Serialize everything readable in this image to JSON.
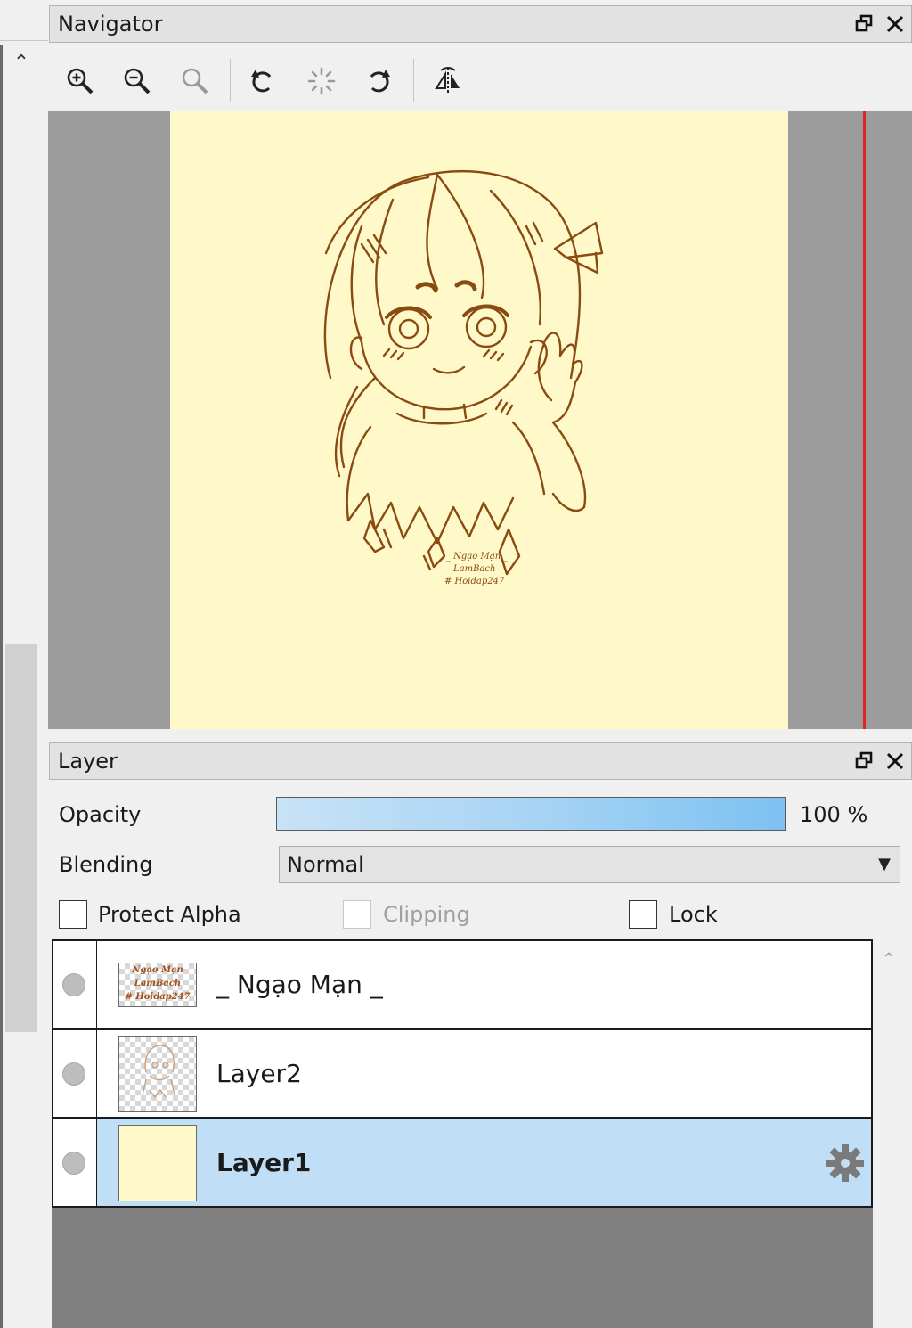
{
  "colors": {
    "panel_bg": "#f0f0f0",
    "titlebar_bg": "#e2e2e2",
    "canvas_bg": "#fff8c8",
    "view_bg": "#9c9c9c",
    "accent_red": "#e0231c",
    "selected_row": "#c0dff7",
    "sketch_line": "#8a4b12"
  },
  "left_strip": {
    "scroll_up_glyph": "⌃"
  },
  "navigator": {
    "title": "Navigator",
    "window_buttons": [
      "restore-icon",
      "close-icon"
    ],
    "toolbar": [
      "zoom-in-icon",
      "zoom-out-icon",
      "zoom-reset-icon",
      "rotate-left-icon",
      "rotate-reset-icon",
      "rotate-right-icon",
      "flip-horizontal-icon"
    ],
    "canvas_watermark": [
      "_ Ngạo Mạn _",
      "LamBach",
      "# Hoidap247"
    ]
  },
  "layer": {
    "title": "Layer",
    "window_buttons": [
      "restore-icon",
      "close-icon"
    ],
    "opacity_label": "Opacity",
    "opacity_value": "100 %",
    "opacity_fraction": 1.0,
    "blending_label": "Blending",
    "blending_value": "Normal",
    "protect_alpha_label": "Protect Alpha",
    "protect_alpha_checked": false,
    "clipping_label": "Clipping",
    "clipping_enabled": false,
    "lock_label": "Lock",
    "lock_checked": false,
    "list_scroll_up_glyph": "⌃",
    "layers": [
      {
        "name": "_ Ngạo Mạn _",
        "thumb_lines": [
          "Ngạo Mạn",
          "LamBach",
          "# Hoidap247"
        ],
        "selected": false
      },
      {
        "name": "Layer2",
        "selected": false
      },
      {
        "name": "Layer1",
        "selected": true
      }
    ]
  }
}
